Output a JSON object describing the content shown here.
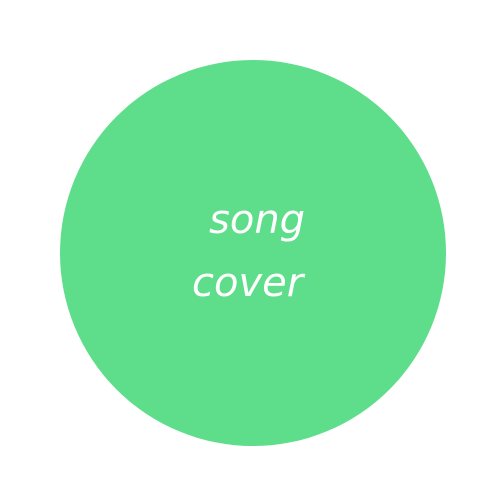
{
  "cover": {
    "line1": "song",
    "line2": "cover",
    "colors": {
      "circle": "#5ede8a",
      "text": "#ffffff",
      "background": "#ffffff"
    }
  }
}
